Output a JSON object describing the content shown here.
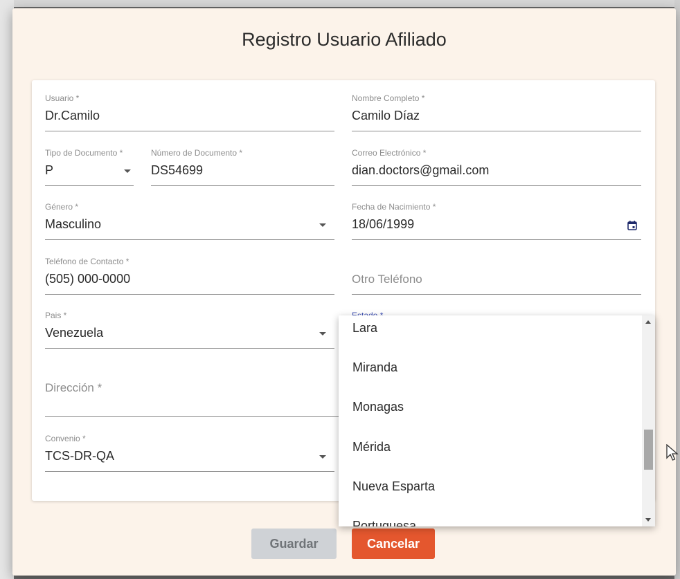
{
  "dialog": {
    "title": "Registro Usuario Afiliado"
  },
  "form": {
    "usuario": {
      "label": "Usuario *",
      "value": "Dr.Camilo"
    },
    "nombre_completo": {
      "label": "Nombre Completo *",
      "value": "Camilo Díaz"
    },
    "tipo_documento": {
      "label": "Tipo de Documento *",
      "value": "P"
    },
    "numero_documento": {
      "label": "Número de Documento *",
      "value": "DS54699"
    },
    "correo": {
      "label": "Correo Electrónico *",
      "value": "dian.doctors@gmail.com"
    },
    "genero": {
      "label": "Género *",
      "value": "Masculino"
    },
    "fecha_nacimiento": {
      "label": "Fecha de Nacimiento *",
      "value": "18/06/1999"
    },
    "telefono_contacto": {
      "label": "Teléfono de Contacto *",
      "value": "(505) 000-0000"
    },
    "otro_telefono": {
      "placeholder": "Otro Teléfono"
    },
    "pais": {
      "label": "Pais *",
      "value": "Venezuela"
    },
    "estado": {
      "label": "Estado *"
    },
    "direccion": {
      "placeholder": "Dirección *"
    },
    "convenio": {
      "label": "Convenio *",
      "value": "TCS-DR-QA"
    }
  },
  "estado_dropdown": {
    "options": [
      "Lara",
      "Miranda",
      "Monagas",
      "Mérida",
      "Nueva Esparta",
      "Portuguesa"
    ]
  },
  "buttons": {
    "save": "Guardar",
    "cancel": "Cancelar"
  },
  "icons": {
    "calendar": "calendar-icon",
    "dropdown": "chevron-down-icon"
  },
  "colors": {
    "dialog_bg": "#fcf3ea",
    "cancel_bg": "#e4572e",
    "save_bg": "#cfd2d6",
    "focus_label": "#3f51b5"
  }
}
